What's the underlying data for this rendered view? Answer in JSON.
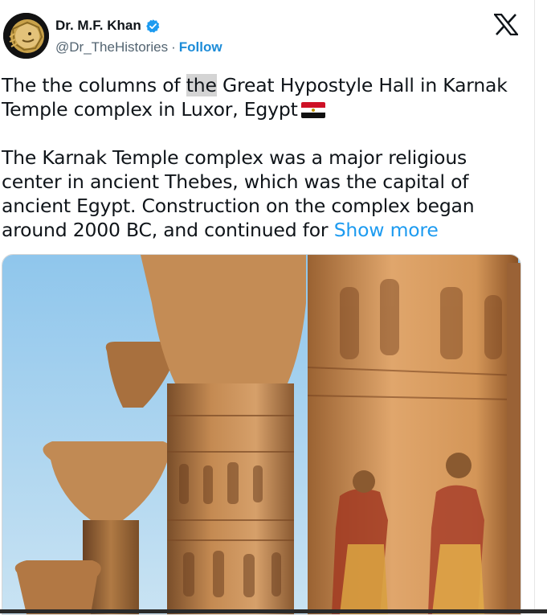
{
  "author": {
    "display_name": "Dr. M.F. Khan",
    "handle": "@Dr_TheHistories",
    "separator": "·",
    "follow_label": "Follow",
    "verified": true,
    "avatar_icon": "golden-lion-avatar"
  },
  "platform_icon": "x-logo-icon",
  "tweet": {
    "line1_pre": "The the columns of ",
    "line1_highlight": "the",
    "line1_post": " Great Hypostyle Hall in Karnak Temple complex in Luxor, Egypt",
    "flag_icon": "egypt-flag-icon",
    "paragraph2": "The Karnak Temple complex was a major religious center in ancient Thebes, which was the capital of ancient Egypt. Construction on the complex began around 2000 BC, and continued for",
    "show_more_label": "Show more"
  },
  "colors": {
    "link": "#1d9bf0",
    "follow": "#1d8cd8",
    "verified": "#1d9bf0",
    "text": "#0f1419",
    "secondary": "#536471",
    "highlight": "#d4d4d4"
  },
  "media": {
    "type": "photo",
    "subject": "carved sandstone columns with painted hieroglyphs against blue sky"
  }
}
